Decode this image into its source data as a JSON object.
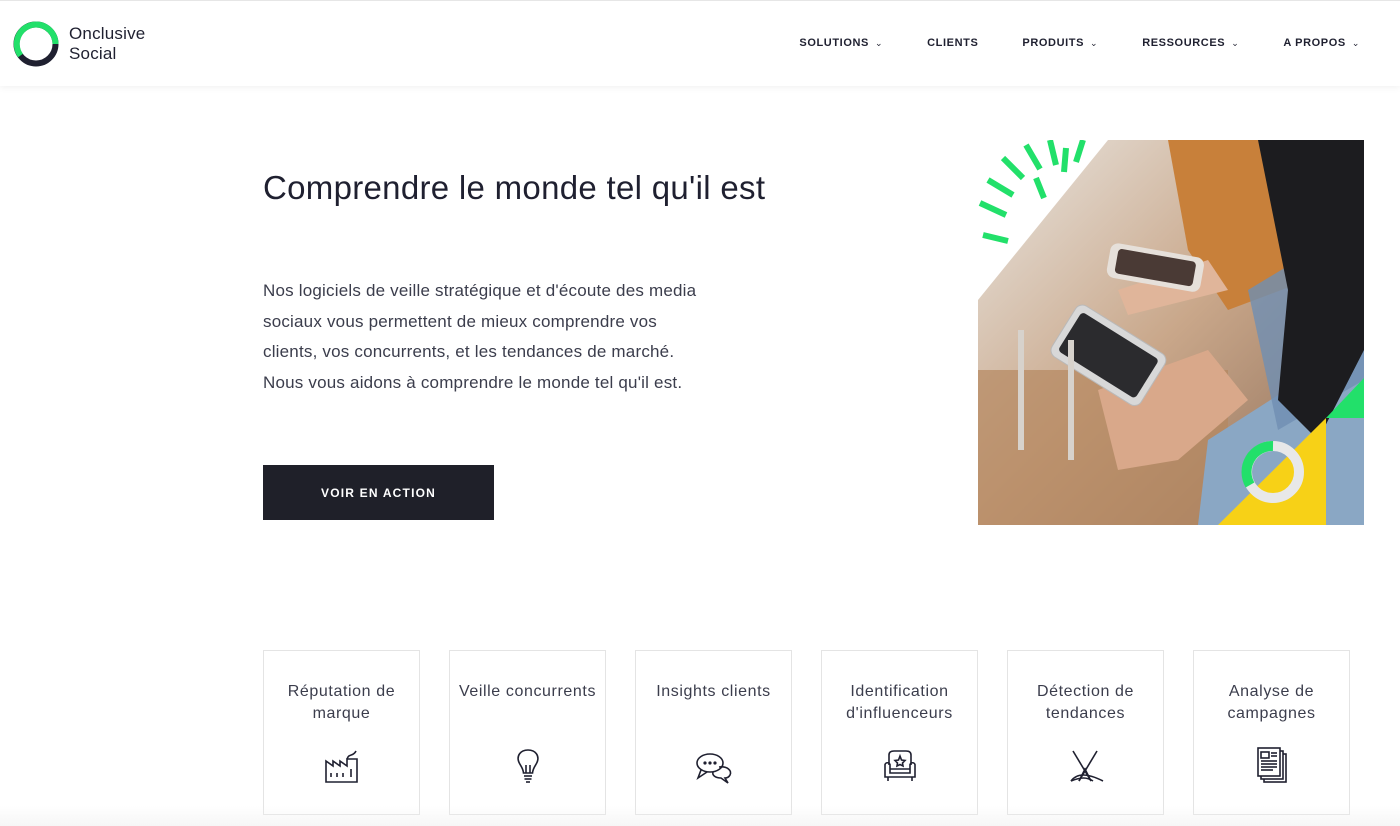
{
  "brand": {
    "name_line1": "Onclusive",
    "name_line2": "Social",
    "accent_color": "#22e06a",
    "dark_color": "#1f2030"
  },
  "nav": {
    "items": [
      {
        "label": "SOLUTIONS",
        "has_dropdown": true
      },
      {
        "label": "CLIENTS",
        "has_dropdown": false
      },
      {
        "label": "PRODUITS",
        "has_dropdown": true
      },
      {
        "label": "RESSOURCES",
        "has_dropdown": true
      },
      {
        "label": "A PROPOS",
        "has_dropdown": true
      }
    ],
    "chevron": "⌄"
  },
  "hero": {
    "title": "Comprendre le monde tel qu'il est",
    "text": "Nos logiciels de veille stratégique et d'écoute des media sociaux vous permettent de mieux comprendre vos clients, vos concurrents, et les tendances de marché. Nous vous aidons à comprendre le monde tel qu'il est.",
    "cta_label": "VOIR EN ACTION",
    "image_icon": "people-with-smartphones-photo"
  },
  "cards": [
    {
      "label": "Réputation de marque",
      "icon": "factory-icon"
    },
    {
      "label": "Veille concurrents",
      "icon": "lightbulb-icon"
    },
    {
      "label": "Insights clients",
      "icon": "chat-bubbles-icon"
    },
    {
      "label": "Identification d'influenceurs",
      "icon": "armchair-icon"
    },
    {
      "label": "Détection de tendances",
      "icon": "trend-lines-icon"
    },
    {
      "label": "Analyse de campagnes",
      "icon": "newspaper-icon"
    }
  ]
}
